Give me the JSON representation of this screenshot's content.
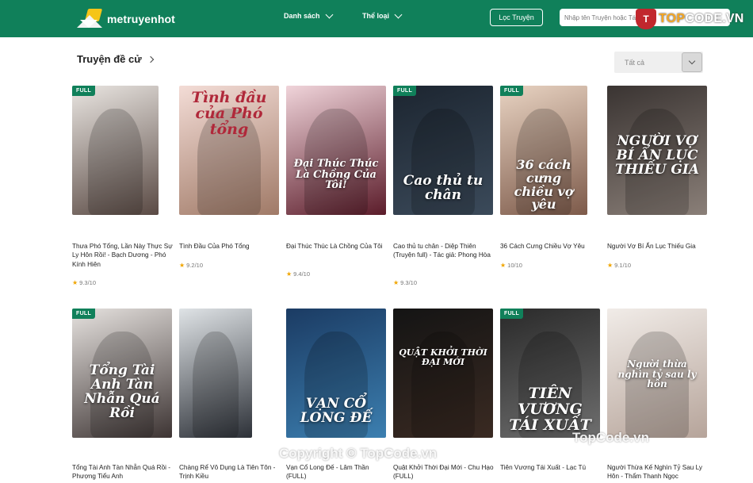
{
  "header": {
    "logo_text": "metruyenhot",
    "nav": [
      {
        "label": "Danh sách"
      },
      {
        "label": "Thể loại"
      }
    ],
    "filter_button": "Lọc Truyện",
    "search_placeholder": "Nhập tên Truyện hoặc Tác giả"
  },
  "watermark": {
    "top_mark": "T",
    "top_text_a": "TOP",
    "top_text_b": "CODE.VN",
    "mid": "TopCode.vn",
    "bottom": "Copyright © TopCode.vn"
  },
  "section": {
    "title": "Truyện đề cử",
    "select_value": "Tất cả"
  },
  "books": [
    {
      "title": "Thưa Phó Tổng, Lần Này Thực Sự Ly Hôn Rồi! - Bạch Dương - Phó Kính Hiên",
      "rating": "9.3/10",
      "badge": "FULL",
      "cover_text": "",
      "colors": [
        "#e9e5e1",
        "#5a4a44"
      ]
    },
    {
      "title": "Tình Đầu Của Phó Tổng",
      "rating": "9.2/10",
      "badge": "",
      "cover_text": "Tình đầu của Phó tổng",
      "colors": [
        "#f3dcd6",
        "#a07a67"
      ]
    },
    {
      "title": "Đại Thúc Thúc Là Chồng Của Tôi",
      "rating": "9.4/10",
      "badge": "",
      "cover_text": "Đại Thúc Thúc Là Chồng Của Tôi!",
      "colors": [
        "#f0d4da",
        "#5b1c2a"
      ]
    },
    {
      "title": "Cao thủ tu chân - Diệp Thiên (Truyện full) - Tác giả: Phong Hòa",
      "rating": "9.3/10",
      "badge": "FULL",
      "cover_text": "Cao thủ tu chân",
      "colors": [
        "#1c2530",
        "#3b4a5a"
      ]
    },
    {
      "title": "36 Cách Cưng Chiều Vợ Yêu",
      "rating": "10/10",
      "badge": "FULL",
      "cover_text": "36 cách cưng chiều vợ yêu",
      "colors": [
        "#e8d3c2",
        "#7d5a4a"
      ]
    },
    {
      "title": "Người Vợ Bí Ẩn Lục Thiếu Gia",
      "rating": "9.1/10",
      "badge": "",
      "cover_text": "NGƯỜI VỢ BÍ ẨN LỤC THIẾU GIA",
      "colors": [
        "#3a3432",
        "#8a7f78"
      ]
    },
    {
      "title": "Tổng Tài Anh Tàn Nhẫn Quá Rồi - Phượng Tiểu Anh",
      "rating": "",
      "badge": "FULL",
      "cover_text": "Tổng Tài Anh Tàn Nhẫn Quá Rồi",
      "colors": [
        "#e6e2df",
        "#3d3433"
      ]
    },
    {
      "title": "Chàng Rể Vô Dụng Là Tiên Tôn - Trịnh Kiều",
      "rating": "",
      "badge": "",
      "cover_text": "",
      "colors": [
        "#dfe3e6",
        "#2d3138"
      ]
    },
    {
      "title": "Vạn Cổ Long Đế - Lâm Thần (FULL)",
      "rating": "",
      "badge": "",
      "cover_text": "VẠN CỔ LONG ĐẾ",
      "colors": [
        "#1b3b63",
        "#3c7fb0"
      ]
    },
    {
      "title": "Quật Khởi Thời Đại Mới - Chu Hạo (FULL)",
      "rating": "",
      "badge": "",
      "cover_text": "QUẬT KHỞI THỜI ĐẠI MỚI",
      "colors": [
        "#141414",
        "#3a2a22"
      ]
    },
    {
      "title": "Tiên Vương Tái Xuất - Lạc Tú",
      "rating": "",
      "badge": "FULL",
      "cover_text": "TIÊN VƯƠNG TÁI XUẤT",
      "colors": [
        "#2a2a2a",
        "#6e6e6e"
      ]
    },
    {
      "title": "Người Thừa Kế Nghìn Tỷ Sau Ly Hôn - Thẩm Thanh Ngọc",
      "rating": "",
      "badge": "",
      "cover_text": "Người thừa nghìn tỷ sau ly hôn",
      "colors": [
        "#f1ece8",
        "#b6a49a"
      ]
    }
  ]
}
